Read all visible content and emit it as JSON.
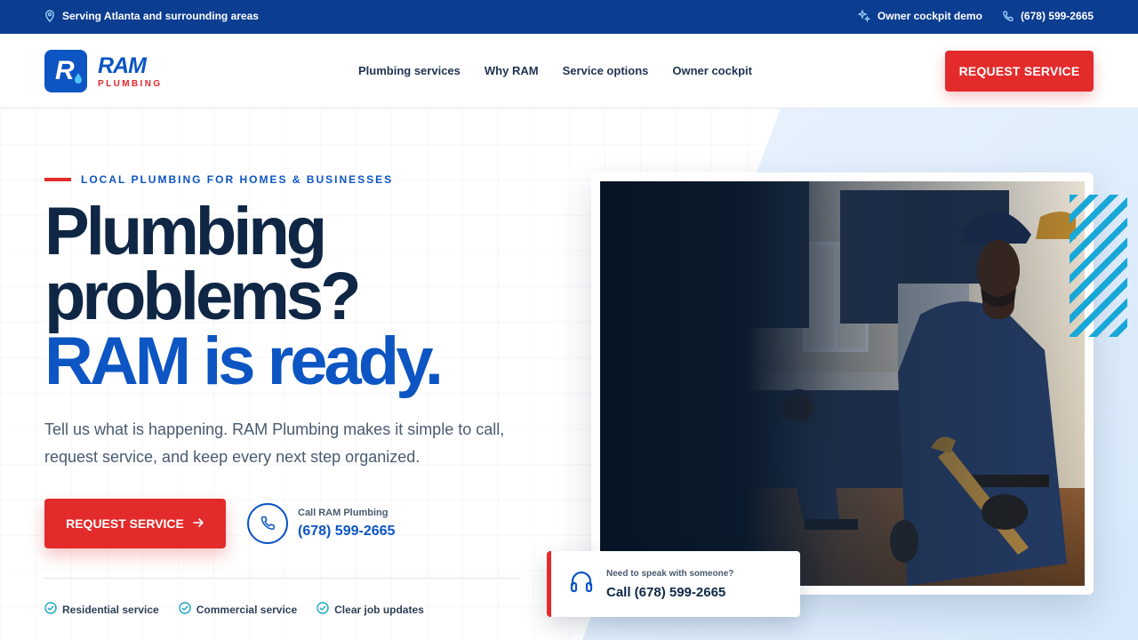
{
  "topbar": {
    "service_area": "Serving Atlanta and surrounding areas",
    "owner_demo": "Owner cockpit demo",
    "phone": "(678) 599-2665"
  },
  "brand": {
    "mark_letter": "R",
    "name": "RAM",
    "tagline": "PLUMBING"
  },
  "nav": {
    "items": [
      "Plumbing services",
      "Why RAM",
      "Service options",
      "Owner cockpit"
    ]
  },
  "header": {
    "cta_label": "REQUEST SERVICE"
  },
  "hero": {
    "eyebrow": "LOCAL PLUMBING FOR HOMES & BUSINESSES",
    "headline_line1": "Plumbing",
    "headline_line2": "problems?",
    "headline_line3": "RAM is ready.",
    "lede": "Tell us what is happening. RAM Plumbing makes it simple to call, request service, and keep every next step organized.",
    "cta_label": "REQUEST SERVICE",
    "call_label": "Call RAM Plumbing",
    "call_number": "(678) 599-2665",
    "features": [
      "Residential service",
      "Commercial service",
      "Clear job updates"
    ]
  },
  "callout": {
    "label": "Need to speak with someone?",
    "number": "Call (678) 599-2665"
  },
  "colors": {
    "brand_blue": "#0c55c3",
    "topbar_navy": "#0b3d91",
    "accent_red": "#e32b2b",
    "stripe_cyan": "#18a8d8",
    "ink": "#0f2745"
  },
  "icons": {
    "topbar_location": "map-pin-icon",
    "topbar_sparkle": "sparkle-icon",
    "topbar_phone": "phone-icon",
    "cta_arrow": "arrow-right-icon",
    "call": "phone-icon",
    "feature": "check-circle-icon",
    "callout": "headset-icon"
  }
}
